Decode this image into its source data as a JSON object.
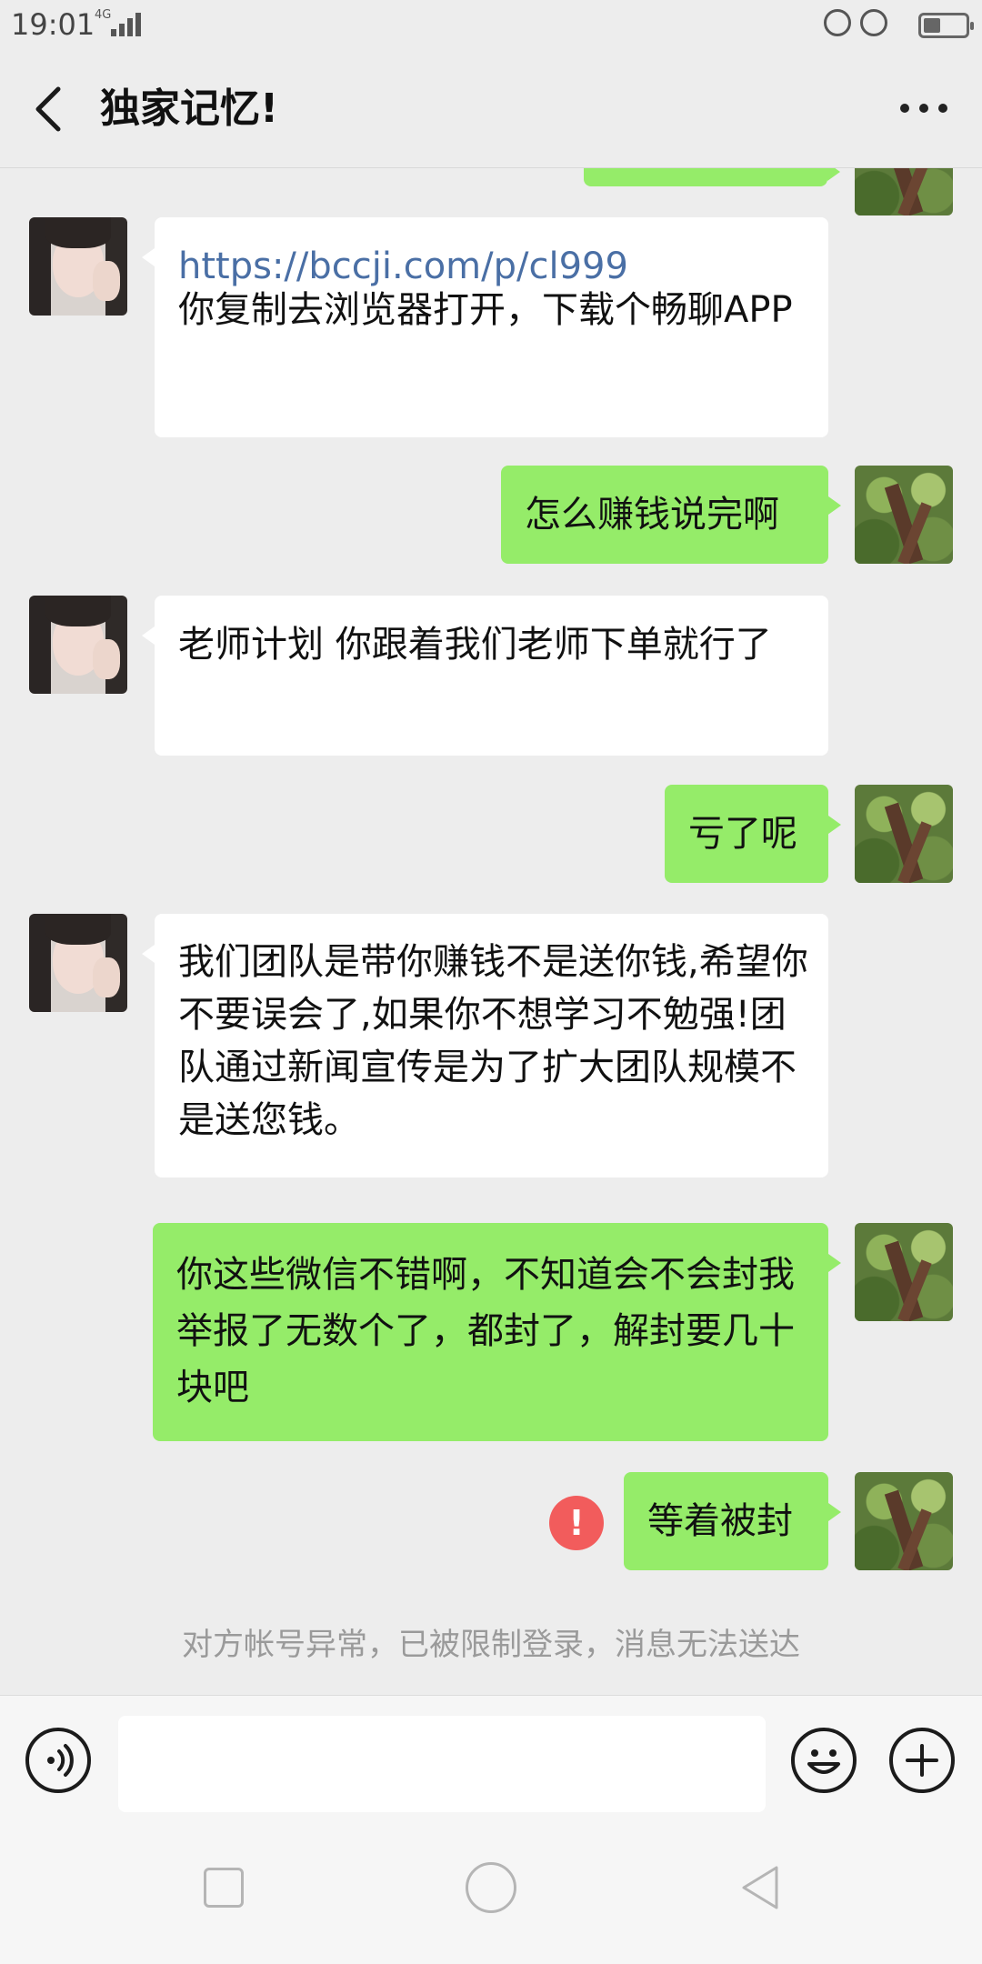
{
  "status_bar": {
    "time": "19:01",
    "network": "4G"
  },
  "header": {
    "title": "独家记忆!"
  },
  "messages": [
    {
      "side": "in",
      "link": "https://bccji.com/p/cl999",
      "text": "  你复制去浏览器打开，下载个畅聊APP"
    },
    {
      "side": "out",
      "text": "怎么赚钱说完啊"
    },
    {
      "side": "in",
      "text": "老师计划  你跟着我们老师下单就行了"
    },
    {
      "side": "out",
      "text": "亏了呢"
    },
    {
      "side": "in",
      "text": "我们团队是带你赚钱不是送你钱,希望你不要误会了,如果你不想学习不勉强!团队通过新闻宣传是为了扩大团队规模不是送您钱。"
    },
    {
      "side": "out",
      "text": "你这些微信不错啊，不知道会不会封我举报了无数个了，都封了，解封要几十块吧"
    },
    {
      "side": "out",
      "text": "等着被封",
      "failed": true,
      "error_mark": "!"
    }
  ],
  "system_note": "对方帐号异常，已被限制登录，消息无法送达",
  "input_bar": {
    "placeholder": ""
  },
  "icons": {
    "back": "back-arrow-icon",
    "more": "more-dots-icon",
    "voice": "voice-icon",
    "emoji": "emoji-icon",
    "plus": "plus-icon",
    "error": "error-icon"
  },
  "colors": {
    "outgoing_bubble": "#95ec69",
    "incoming_bubble": "#ffffff",
    "error": "#f25c5c",
    "link": "#4a6fa5"
  }
}
